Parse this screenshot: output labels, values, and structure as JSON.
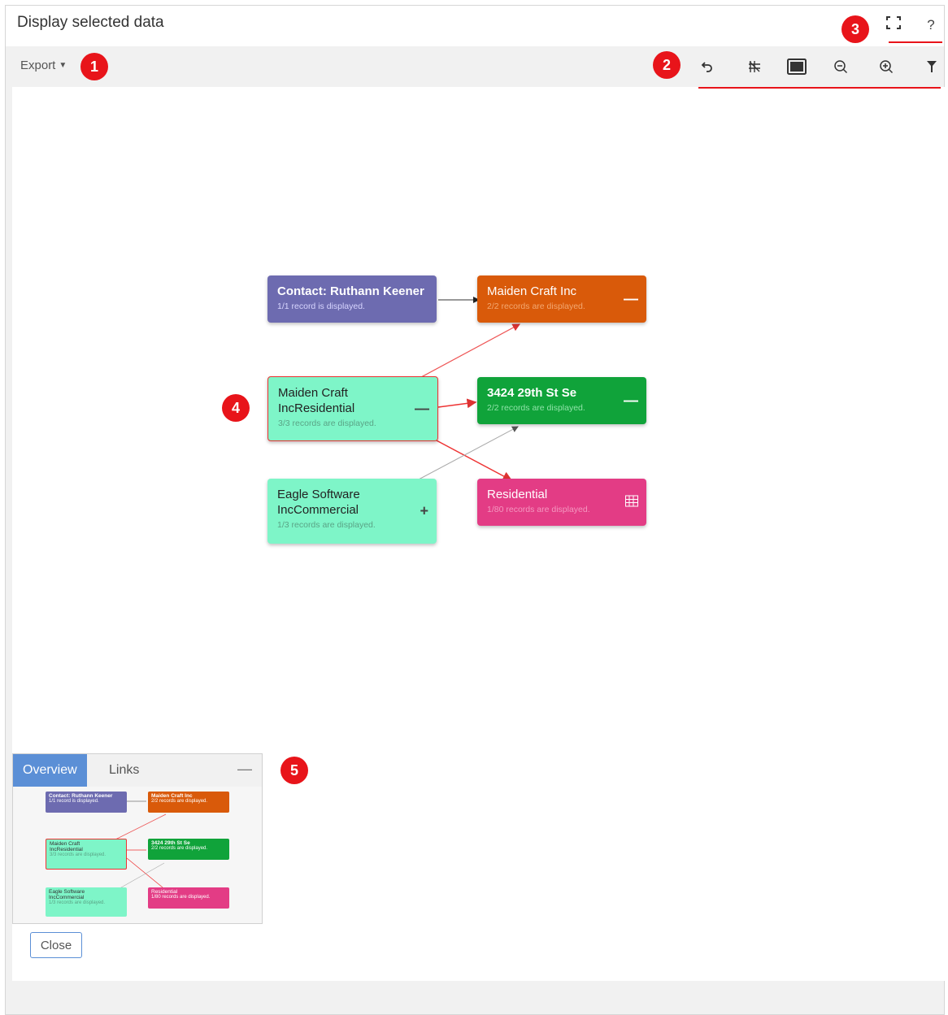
{
  "dialog": {
    "title": "Display selected data"
  },
  "toolbar": {
    "export_label": "Export",
    "tools": [
      "undo-icon",
      "hierarchy-icon",
      "fit-screen-icon",
      "zoom-out-icon",
      "zoom-in-icon",
      "filter-icon"
    ]
  },
  "window_controls": {
    "fullscreen_icon": "fullscreen-icon",
    "help_label": "?"
  },
  "markers": [
    "1",
    "2",
    "3",
    "4",
    "5"
  ],
  "graph": {
    "nodes": [
      {
        "id": "contact",
        "name": "Contact: Ruthann Keener",
        "sub": "1/1 record is displayed.",
        "color": "#6d6bb0",
        "control": ""
      },
      {
        "id": "maiden_inc",
        "name": "Maiden Craft Inc",
        "sub": "2/2 records are displayed.",
        "color": "#d95a0a",
        "control": "—"
      },
      {
        "id": "maiden_res",
        "name": "Maiden Craft IncResidential",
        "sub": "3/3 records are displayed.",
        "color": "#7ef5c8",
        "control": "—"
      },
      {
        "id": "address",
        "name": "3424 29th St Se",
        "sub": "2/2 records are displayed.",
        "color": "#10a33a",
        "control": "—"
      },
      {
        "id": "eagle",
        "name": "Eagle Software IncCommercial",
        "sub": "1/3 records are displayed.",
        "color": "#7ef5c8",
        "control": "+"
      },
      {
        "id": "residential",
        "name": "Residential",
        "sub": "1/80 records are displayed.",
        "color": "#e33c85",
        "control": "table-icon"
      }
    ]
  },
  "overview": {
    "tabs": [
      "Overview",
      "Links"
    ],
    "active_tab": "Overview",
    "minimize_label": "—",
    "mini_nodes": [
      {
        "name": "Contact: Ruthann Keener",
        "sub": "1/1 record is displayed."
      },
      {
        "name": "Maiden Craft Inc",
        "sub": "2/2 records are displayed."
      },
      {
        "name": "Maiden Craft IncResidential",
        "sub": "3/3 records are displayed."
      },
      {
        "name": "3424 29th St Se",
        "sub": "2/2 records are displayed."
      },
      {
        "name": "Eagle Software IncCommercial",
        "sub": "1/3 records are displayed."
      },
      {
        "name": "Residential",
        "sub": "1/80 records are displayed."
      }
    ]
  },
  "close_label": "Close"
}
